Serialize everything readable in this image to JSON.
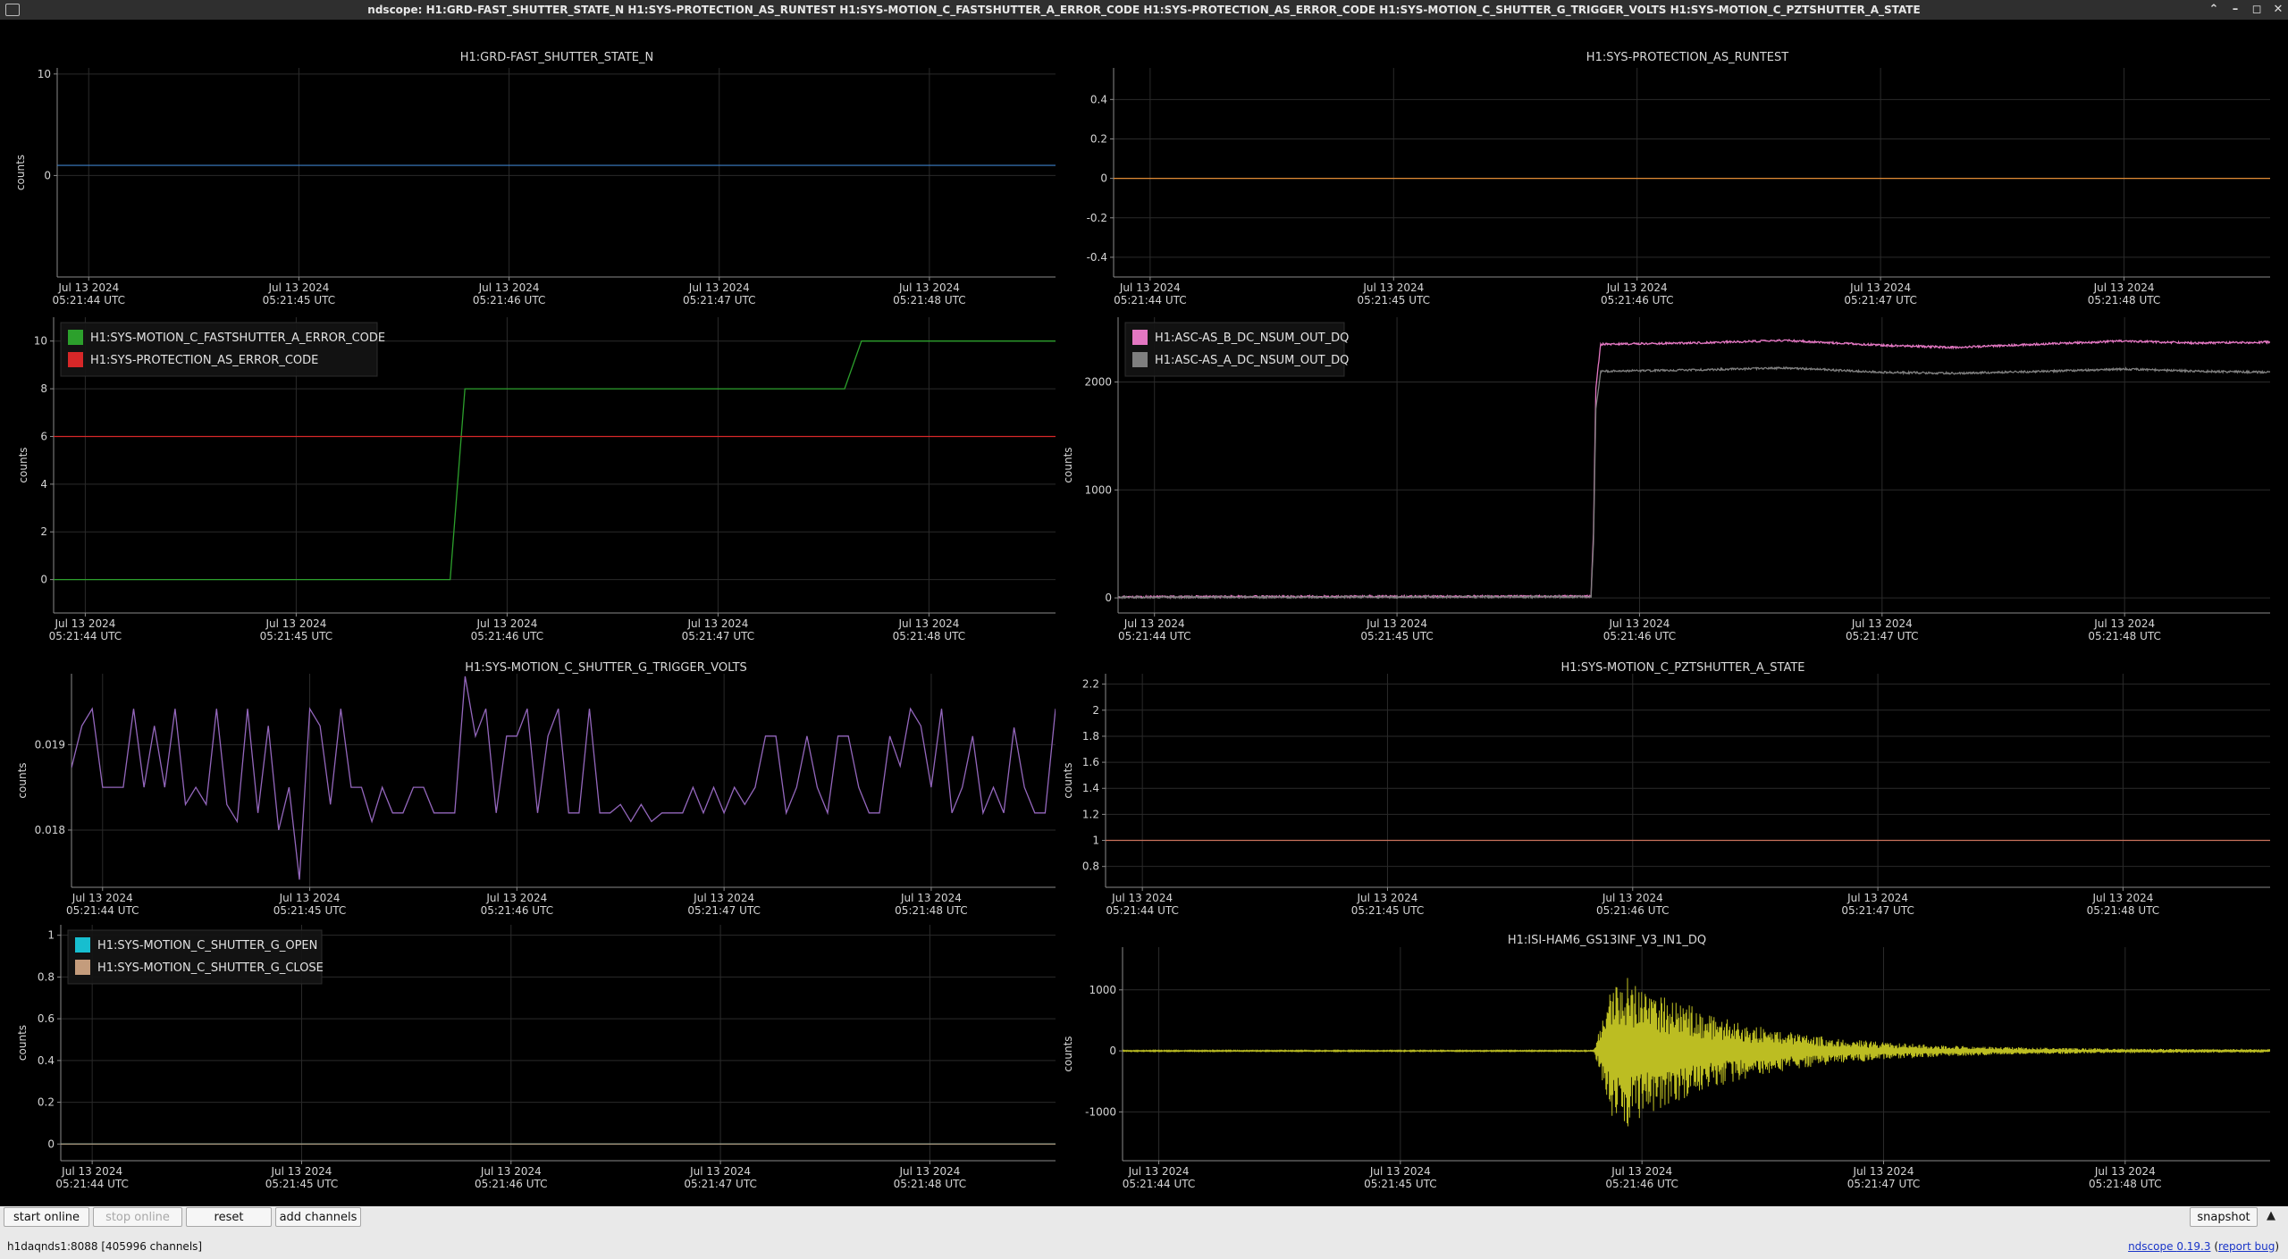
{
  "window": {
    "title": "ndscope: H1:GRD-FAST_SHUTTER_STATE_N H1:SYS-PROTECTION_AS_RUNTEST H1:SYS-MOTION_C_FASTSHUTTER_A_ERROR_CODE H1:SYS-PROTECTION_AS_ERROR_CODE H1:SYS-MOTION_C_SHUTTER_G_TRIGGER_VOLTS H1:SYS-MOTION_C_PZTSHUTTER_A_STATE",
    "controls": [
      "minimize",
      "maximize",
      "restore",
      "close"
    ]
  },
  "axis": {
    "ylabel": "counts",
    "time_ticks": [
      {
        "date": "Jul 13 2024",
        "time": "05:21:44 UTC"
      },
      {
        "date": "Jul 13 2024",
        "time": "05:21:45 UTC"
      },
      {
        "date": "Jul 13 2024",
        "time": "05:21:46 UTC"
      },
      {
        "date": "Jul 13 2024",
        "time": "05:21:47 UTC"
      },
      {
        "date": "Jul 13 2024",
        "time": "05:21:48 UTC"
      }
    ]
  },
  "chart_data": [
    {
      "type": "line",
      "title": "H1:GRD-FAST_SHUTTER_STATE_N",
      "ylabel": "counts",
      "ylim": [
        -10,
        10.6
      ],
      "yticks": [
        0,
        10
      ],
      "yticks_labels": [
        "0",
        "10"
      ],
      "grid": true,
      "xlim": [
        43.85,
        48.6
      ],
      "legend": [],
      "series": [
        {
          "color": "#3d7fc9",
          "kind": "const",
          "y": 1
        }
      ]
    },
    {
      "type": "line",
      "title": "H1:SYS-PROTECTION_AS_RUNTEST",
      "ylabel": "",
      "ylim": [
        -0.5,
        0.56
      ],
      "yticks": [
        -0.4,
        -0.2,
        0,
        0.2,
        0.4
      ],
      "yticks_labels": [
        "-0.4",
        "-0.2",
        "0",
        "0.2",
        "0.4"
      ],
      "grid": true,
      "xlim": [
        43.85,
        48.6
      ],
      "legend": [],
      "series": [
        {
          "color": "#e08a34",
          "kind": "const",
          "y": 0
        }
      ]
    },
    {
      "type": "line",
      "title": "",
      "ylabel": "counts",
      "ylim": [
        -1.4,
        11
      ],
      "yticks": [
        0,
        2,
        4,
        6,
        8,
        10
      ],
      "yticks_labels": [
        "0",
        "2",
        "4",
        "6",
        "8",
        "10"
      ],
      "grid": true,
      "xlim": [
        43.85,
        48.6
      ],
      "legend": [
        {
          "name": "H1:SYS-MOTION_C_FASTSHUTTER_A_ERROR_CODE",
          "color": "#2ca02c"
        },
        {
          "name": "H1:SYS-PROTECTION_AS_ERROR_CODE",
          "color": "#d62728"
        }
      ],
      "series": [
        {
          "name": "H1:SYS-MOTION_C_FASTSHUTTER_A_ERROR_CODE",
          "color": "#2ca02c",
          "kind": "points",
          "x": [
            43.85,
            45.73,
            45.8,
            47.6,
            47.68,
            48.6
          ],
          "y": [
            0,
            0,
            8,
            8,
            10,
            10
          ]
        },
        {
          "name": "H1:SYS-PROTECTION_AS_ERROR_CODE",
          "color": "#d62728",
          "kind": "const",
          "y": 6
        }
      ]
    },
    {
      "type": "line",
      "title": "",
      "ylabel": "counts",
      "ylim": [
        -140,
        2600
      ],
      "yticks": [
        0,
        1000,
        2000
      ],
      "yticks_labels": [
        "0",
        "1000",
        "2000"
      ],
      "grid": true,
      "xlim": [
        43.85,
        48.6
      ],
      "legend": [
        {
          "name": "H1:ASC-AS_B_DC_NSUM_OUT_DQ",
          "color": "#e377c2"
        },
        {
          "name": "H1:ASC-AS_A_DC_NSUM_OUT_DQ",
          "color": "#7f7f7f"
        }
      ],
      "series": [
        {
          "name": "H1:ASC-AS_B_DC_NSUM_OUT_DQ",
          "color": "#e377c2",
          "kind": "points",
          "x": [
            43.85,
            45.8,
            45.81,
            45.82,
            45.84,
            46.2,
            46.6,
            47.0,
            47.3,
            47.7,
            48.0,
            48.3,
            48.6
          ],
          "y": [
            10,
            15,
            600,
            1950,
            2350,
            2360,
            2385,
            2340,
            2320,
            2355,
            2380,
            2360,
            2370
          ]
        },
        {
          "name": "H1:ASC-AS_A_DC_NSUM_OUT_DQ",
          "color": "#7f7f7f",
          "kind": "points",
          "x": [
            43.85,
            45.8,
            45.81,
            45.82,
            45.84,
            46.2,
            46.6,
            47.0,
            47.3,
            47.7,
            48.0,
            48.3,
            48.6
          ],
          "y": [
            5,
            10,
            500,
            1750,
            2100,
            2110,
            2130,
            2090,
            2080,
            2100,
            2120,
            2100,
            2090
          ]
        }
      ]
    },
    {
      "type": "line",
      "title": "H1:SYS-MOTION_C_SHUTTER_G_TRIGGER_VOLTS",
      "ylabel": "counts",
      "ylim": [
        0.01733,
        0.01983
      ],
      "yticks": [
        0.018,
        0.019
      ],
      "yticks_labels": [
        "0.018",
        "0.019"
      ],
      "grid": true,
      "xlim": [
        43.85,
        48.6
      ],
      "legend": [],
      "series": [
        {
          "name": "H1:SYS-MOTION_C_SHUTTER_G_TRIGGER_VOLTS",
          "color": "#9467bd",
          "kind": "points",
          "x": [
            43.85,
            43.9,
            43.95,
            44.0,
            44.05,
            44.1,
            44.15,
            44.2,
            44.25,
            44.3,
            44.35,
            44.4,
            44.45,
            44.5,
            44.55,
            44.6,
            44.65,
            44.7,
            44.75,
            44.8,
            44.85,
            44.9,
            44.95,
            45.0,
            45.05,
            45.1,
            45.15,
            45.2,
            45.25,
            45.3,
            45.35,
            45.4,
            45.45,
            45.5,
            45.55,
            45.6,
            45.65,
            45.7,
            45.75,
            45.8,
            45.85,
            45.9,
            45.95,
            46.0,
            46.05,
            46.1,
            46.15,
            46.2,
            46.25,
            46.3,
            46.35,
            46.4,
            46.45,
            46.5,
            46.55,
            46.6,
            46.65,
            46.7,
            46.75,
            46.8,
            46.85,
            46.9,
            46.95,
            47.0,
            47.05,
            47.1,
            47.15,
            47.2,
            47.25,
            47.3,
            47.35,
            47.4,
            47.45,
            47.5,
            47.55,
            47.6,
            47.65,
            47.7,
            47.75,
            47.8,
            47.85,
            47.9,
            47.95,
            48.0,
            48.05,
            48.1,
            48.15,
            48.2,
            48.25,
            48.3,
            48.35,
            48.4,
            48.45,
            48.5,
            48.55,
            48.6
          ],
          "y": [
            0.01873,
            0.01922,
            0.01942,
            0.0185,
            0.0185,
            0.0185,
            0.01942,
            0.0185,
            0.01922,
            0.0185,
            0.01942,
            0.0183,
            0.0185,
            0.0183,
            0.01942,
            0.0183,
            0.0181,
            0.01942,
            0.0182,
            0.01922,
            0.018,
            0.0185,
            0.01742,
            0.01942,
            0.01922,
            0.0183,
            0.01942,
            0.0185,
            0.0185,
            0.0181,
            0.0185,
            0.0182,
            0.0182,
            0.0185,
            0.0185,
            0.0182,
            0.0182,
            0.0182,
            0.0198,
            0.0191,
            0.01942,
            0.0182,
            0.0191,
            0.0191,
            0.01942,
            0.0182,
            0.0191,
            0.01942,
            0.0182,
            0.0182,
            0.01942,
            0.0182,
            0.0182,
            0.0183,
            0.0181,
            0.0183,
            0.0181,
            0.0182,
            0.0182,
            0.0182,
            0.0185,
            0.0182,
            0.0185,
            0.0182,
            0.0185,
            0.0183,
            0.0185,
            0.0191,
            0.0191,
            0.0182,
            0.0185,
            0.0191,
            0.0185,
            0.0182,
            0.0191,
            0.0191,
            0.0185,
            0.0182,
            0.0182,
            0.0191,
            0.01875,
            0.01942,
            0.01922,
            0.0185,
            0.01942,
            0.0182,
            0.0185,
            0.0191,
            0.0182,
            0.0185,
            0.0182,
            0.0192,
            0.0185,
            0.0182,
            0.0182,
            0.01942
          ]
        }
      ]
    },
    {
      "type": "line",
      "title": "H1:SYS-MOTION_C_PZTSHUTTER_A_STATE",
      "ylabel": "counts",
      "ylim": [
        0.64,
        2.28
      ],
      "yticks": [
        0.8,
        1,
        1.2,
        1.4,
        1.6,
        1.8,
        2,
        2.2
      ],
      "yticks_labels": [
        "0.8",
        "1",
        "1.2",
        "1.4",
        "1.6",
        "1.8",
        "2",
        "2.2"
      ],
      "grid": true,
      "xlim": [
        43.85,
        48.6
      ],
      "legend": [],
      "series": [
        {
          "color": "#c9725b",
          "kind": "const",
          "y": 1
        }
      ]
    },
    {
      "type": "line",
      "title": "",
      "ylabel": "counts",
      "ylim": [
        -0.08,
        1.05
      ],
      "yticks": [
        0,
        0.2,
        0.4,
        0.6,
        0.8,
        1
      ],
      "yticks_labels": [
        "0",
        "0.2",
        "0.4",
        "0.6",
        "0.8",
        "1"
      ],
      "grid": true,
      "xlim": [
        43.85,
        48.6
      ],
      "legend": [
        {
          "name": "H1:SYS-MOTION_C_SHUTTER_G_OPEN",
          "color": "#17becf"
        },
        {
          "name": "H1:SYS-MOTION_C_SHUTTER_G_CLOSE",
          "color": "#c49c7c"
        }
      ],
      "series": [
        {
          "name": "H1:SYS-MOTION_C_SHUTTER_G_OPEN",
          "color": "#17becf",
          "kind": "const",
          "y": 0
        },
        {
          "name": "H1:SYS-MOTION_C_SHUTTER_G_CLOSE",
          "color": "#c49c7c",
          "kind": "const",
          "y": 0
        }
      ]
    },
    {
      "type": "line",
      "title": "H1:ISI-HAM6_GS13INF_V3_IN1_DQ",
      "ylabel": "counts",
      "ylim": [
        -1800,
        1700
      ],
      "yticks": [
        -1000,
        0,
        1000
      ],
      "yticks_labels": [
        "-1000",
        "0",
        "1000"
      ],
      "grid": true,
      "xlim": [
        43.85,
        48.6
      ],
      "legend": [],
      "series": [
        {
          "name": "H1:ISI-HAM6_GS13INF_V3_IN1_DQ",
          "color": "#bcbd22",
          "kind": "burst",
          "baseline": 0,
          "noise": 10,
          "start": 45.8,
          "peak_time": 45.9,
          "peak": 1400,
          "decay": 0.45,
          "tail_noise": 25
        }
      ]
    }
  ],
  "toolbar": {
    "start_online": "start online",
    "stop_online": "stop online",
    "reset": "reset",
    "add_channels": "add channels",
    "snapshot": "snapshot"
  },
  "status": {
    "server": "h1daqnds1:8088",
    "channels": "[405996 channels]"
  },
  "version": {
    "name": "ndscope",
    "number": "0.19.3",
    "report_bug": "report bug"
  }
}
